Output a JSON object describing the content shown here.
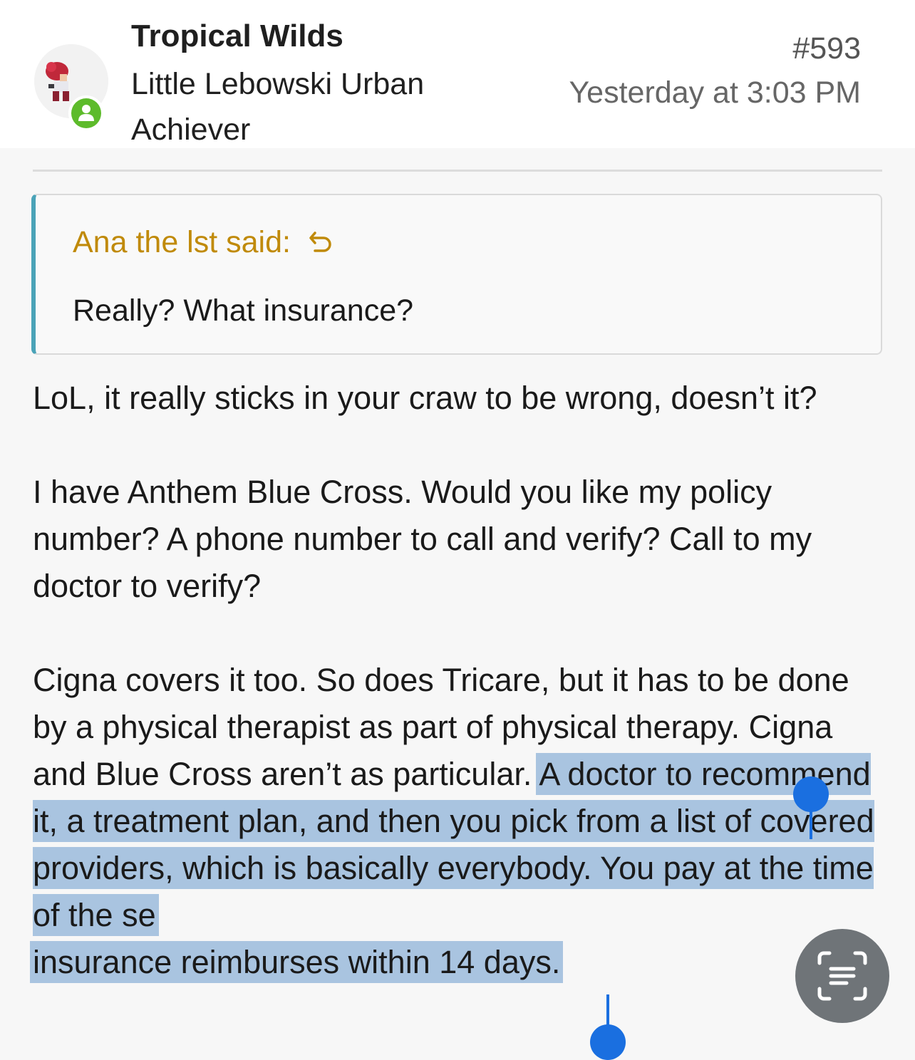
{
  "post": {
    "username": "Tropical Wilds",
    "user_title": "Little Lebowski Urban Achiever",
    "post_number": "#593",
    "timestamp": "Yesterday at 3:03 PM"
  },
  "quote": {
    "attribution": "Ana the lst said:",
    "text": "Really? What insurance?"
  },
  "body": {
    "p1": "LoL, it really sticks in your craw to be wrong, doesn’t it?",
    "p2": "I have Anthem Blue Cross. Would you like my policy number? A phone number to call and verify? Call to my doctor to verify?",
    "p3_plain": "Cigna covers it too. So does Tricare, but it has to be done by a physical therapist as part of physical therapy. Cigna and Blue Cross aren’t as particular. ",
    "p3_selected": "A doctor to recommend it, a treatment plan, and then you pick from a list of covered providers, which is basically everybody. You pay at the time of the se",
    "p3_selected_end": "insurance reimburses within 14 days."
  },
  "icons": {
    "jump": "reply-arrow-icon",
    "online": "online-status-icon",
    "live_text": "live-text-scan-icon"
  },
  "colors": {
    "online_badge": "#5dbb2b",
    "quote_attribution": "#c08a0a",
    "quote_border": "#4aa3b8",
    "selection": "#a9c4e0",
    "selection_handle": "#1a6fe0"
  }
}
